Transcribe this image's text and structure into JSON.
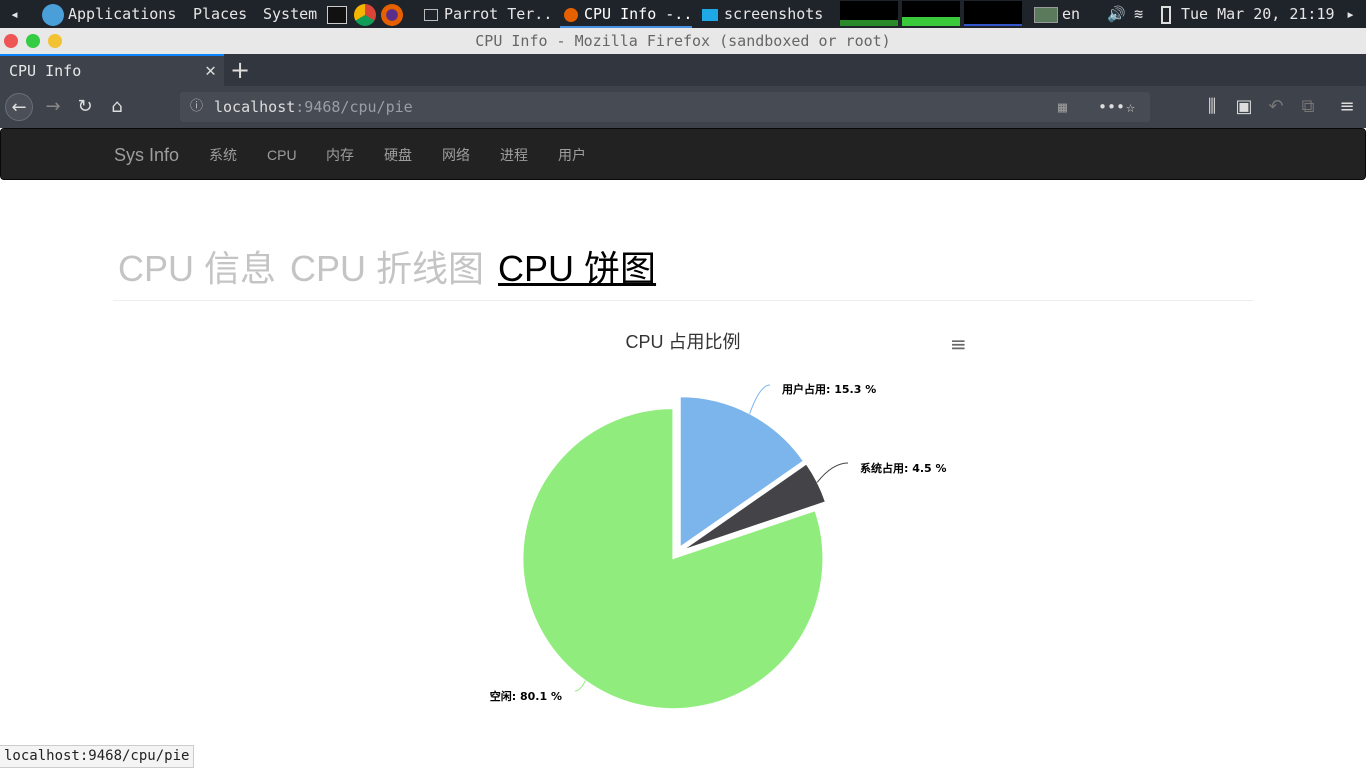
{
  "system_panel": {
    "applications": "Applications",
    "places": "Places",
    "system": "System",
    "tasks": [
      "Parrot Ter...",
      "CPU Info -...",
      "screenshots"
    ],
    "lang": "en",
    "clock": "Tue Mar 20, 21:19"
  },
  "window": {
    "title": "CPU Info - Mozilla Firefox (sandboxed or root)"
  },
  "browser": {
    "tab_title": "CPU Info",
    "url_host": "localhost",
    "url_rest": ":9468/cpu/pie",
    "status": "localhost:9468/cpu/pie"
  },
  "site": {
    "brand": "Sys Info",
    "nav": [
      "系统",
      "CPU",
      "内存",
      "硬盘",
      "网络",
      "进程",
      "用户"
    ],
    "heading_tabs": [
      "CPU 信息",
      "CPU 折线图",
      "CPU 饼图"
    ]
  },
  "colors": {
    "user": "#7cb5ec",
    "system": "#434348",
    "idle": "#90ed7d"
  },
  "chart_data": {
    "type": "pie",
    "title": "CPU 占用比例",
    "slices": [
      {
        "name": "用户占用",
        "value": 15.3,
        "label": "用户占用: 15.3 %"
      },
      {
        "name": "系统占用",
        "value": 4.5,
        "label": "系统占用: 4.5 %"
      },
      {
        "name": "空闲",
        "value": 80.1,
        "label": "空闲: 80.1 %"
      }
    ]
  }
}
